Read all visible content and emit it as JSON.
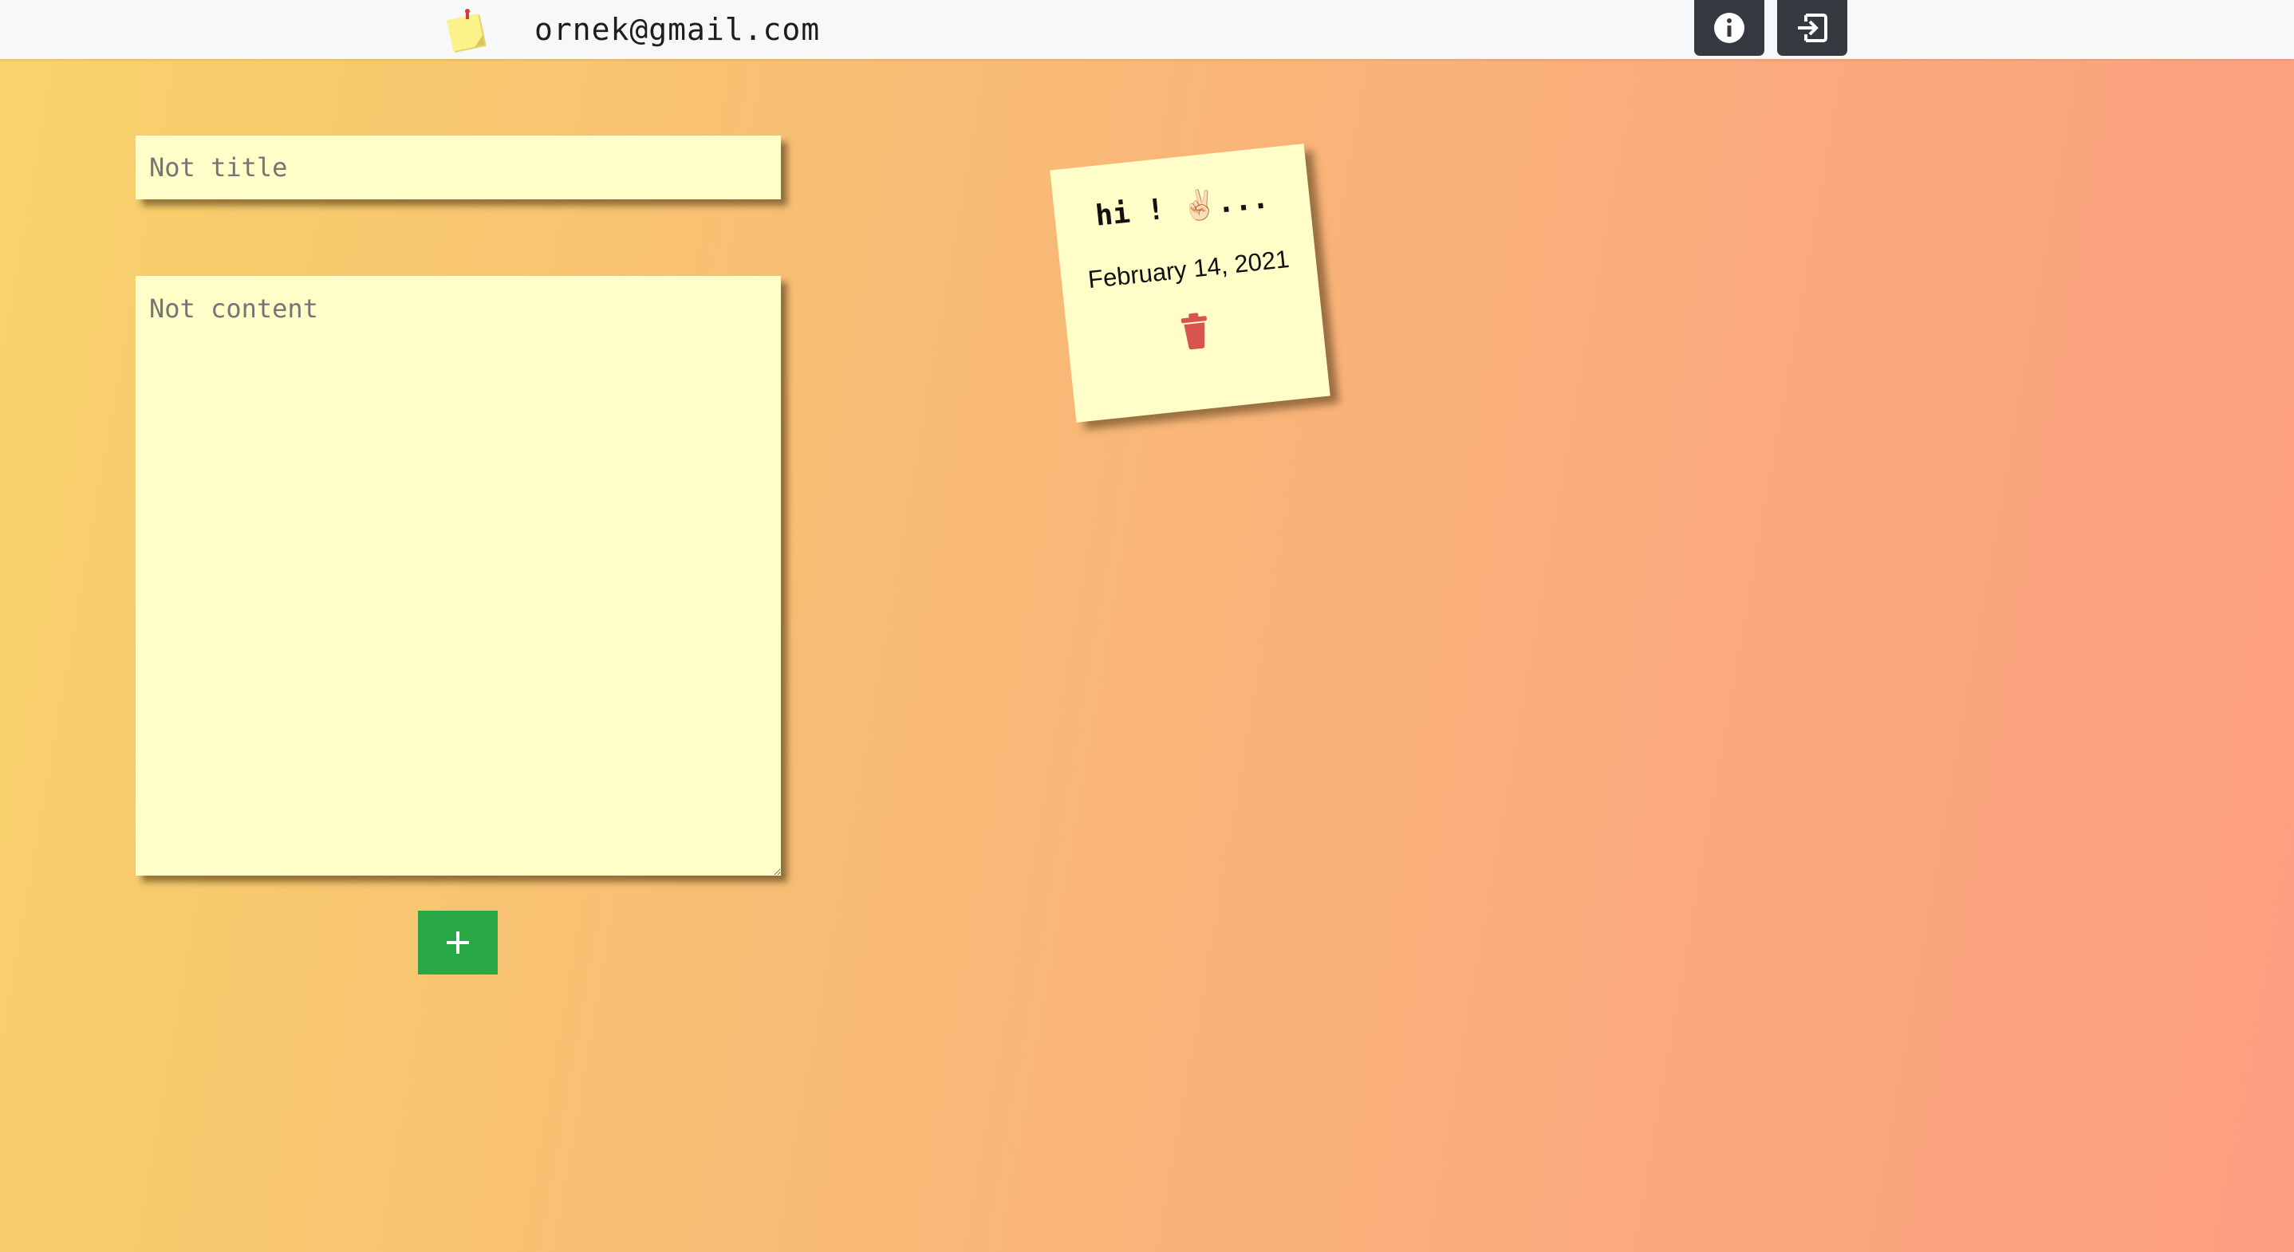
{
  "header": {
    "logo_icon": "sticky-note-icon",
    "user_email": "ornek@gmail.com",
    "info_icon": "info-circle-icon",
    "logout_icon": "sign-out-icon",
    "bar_color": "#f7f8fa",
    "button_color": "#343a40"
  },
  "form": {
    "title_placeholder": "Not title",
    "content_placeholder": "Not content",
    "add_icon": "plus-icon",
    "add_button_color": "#28a745"
  },
  "notes": [
    {
      "title": "hi ! ✌🏻...",
      "date": "February 14, 2021",
      "delete_icon": "trash-icon",
      "delete_color": "#d9534f"
    }
  ],
  "colors": {
    "note_background": "#fffdc8",
    "gradient_start": "#f8d36a",
    "gradient_end": "#fc9e81"
  }
}
